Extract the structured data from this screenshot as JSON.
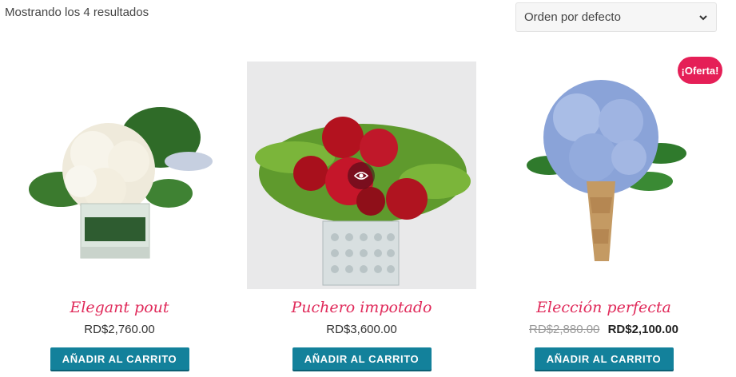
{
  "toolbar": {
    "result_count": "Mostrando los 4 resultados",
    "ordering_selected": "Orden por defecto"
  },
  "products": [
    {
      "name": "Elegant pout",
      "price": "RD$2,760.00",
      "button": "Añadir al carrito"
    },
    {
      "name": "Puchero impotado",
      "price": "RD$3,600.00",
      "button": "Añadir al carrito"
    },
    {
      "name": "Elección perfecta",
      "price_old": "RD$2,880.00",
      "price": "RD$2,100.00",
      "button": "Añadir al carrito",
      "badge": "¡Oferta!"
    }
  ],
  "colors": {
    "accent_pink": "#e02a5a",
    "button_teal": "#13819b",
    "badge_red": "#e51f57"
  },
  "icons": [
    "chevron-down-icon",
    "eye-icon"
  ]
}
